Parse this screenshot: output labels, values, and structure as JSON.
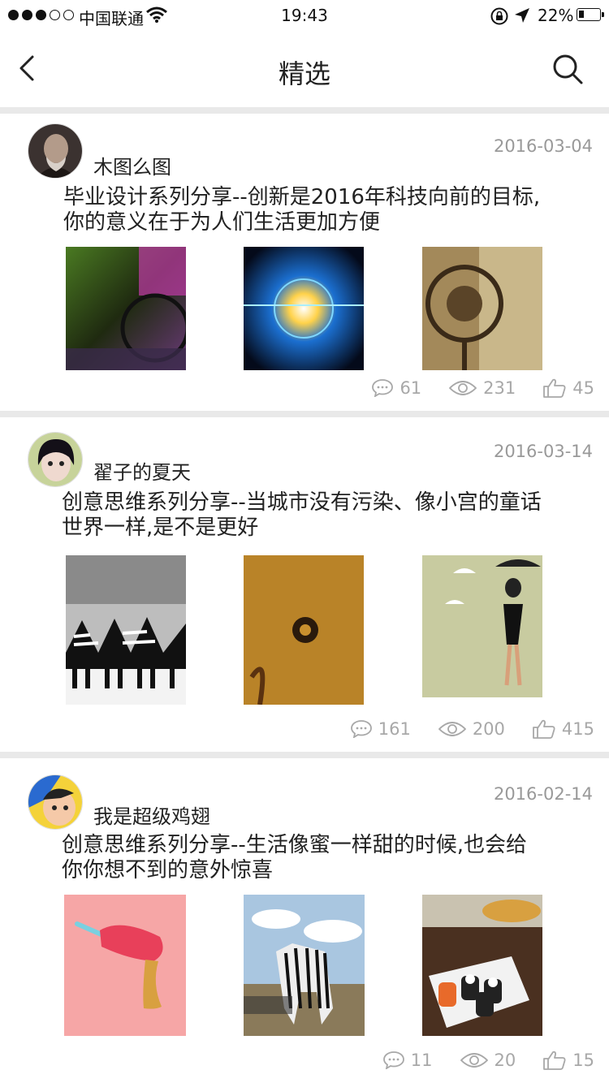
{
  "status_bar": {
    "carrier": "中国联通",
    "time": "19:43",
    "battery": "22%",
    "battery_level": 0.22,
    "signal_bars": 3
  },
  "nav": {
    "title": "精选",
    "back_icon": "chevron-left-icon",
    "search_icon": "search-icon"
  },
  "posts": [
    {
      "author": "木图么图",
      "date": "2016-03-04",
      "title_line1": "毕业设计系列分享--创新是2016年科技向前的目标,",
      "title_line2": "你的意义在于为人们生活更加方便",
      "comments": "61",
      "views": "231",
      "likes": "45"
    },
    {
      "author": "翟子的夏天",
      "date": "2016-03-14",
      "title_line1": "创意思维系列分享--当城市没有污染、像小宫的童话",
      "title_line2": "世界一样,是不是更好",
      "comments": "161",
      "views": "200",
      "likes": "415"
    },
    {
      "author": "我是超级鸡翅",
      "date": "2016-02-14",
      "title_line1": "创意思维系列分享--生活像蜜一样甜的时候,也会给",
      "title_line2": "你你想不到的意外惊喜",
      "comments": "11",
      "views": "20",
      "likes": "15"
    }
  ],
  "icons": {
    "comment": "comment-icon",
    "view": "eye-icon",
    "like": "thumbs-up-icon"
  },
  "colors": {
    "meta_text": "#a8a8a8",
    "separator": "#e9e9e9"
  }
}
